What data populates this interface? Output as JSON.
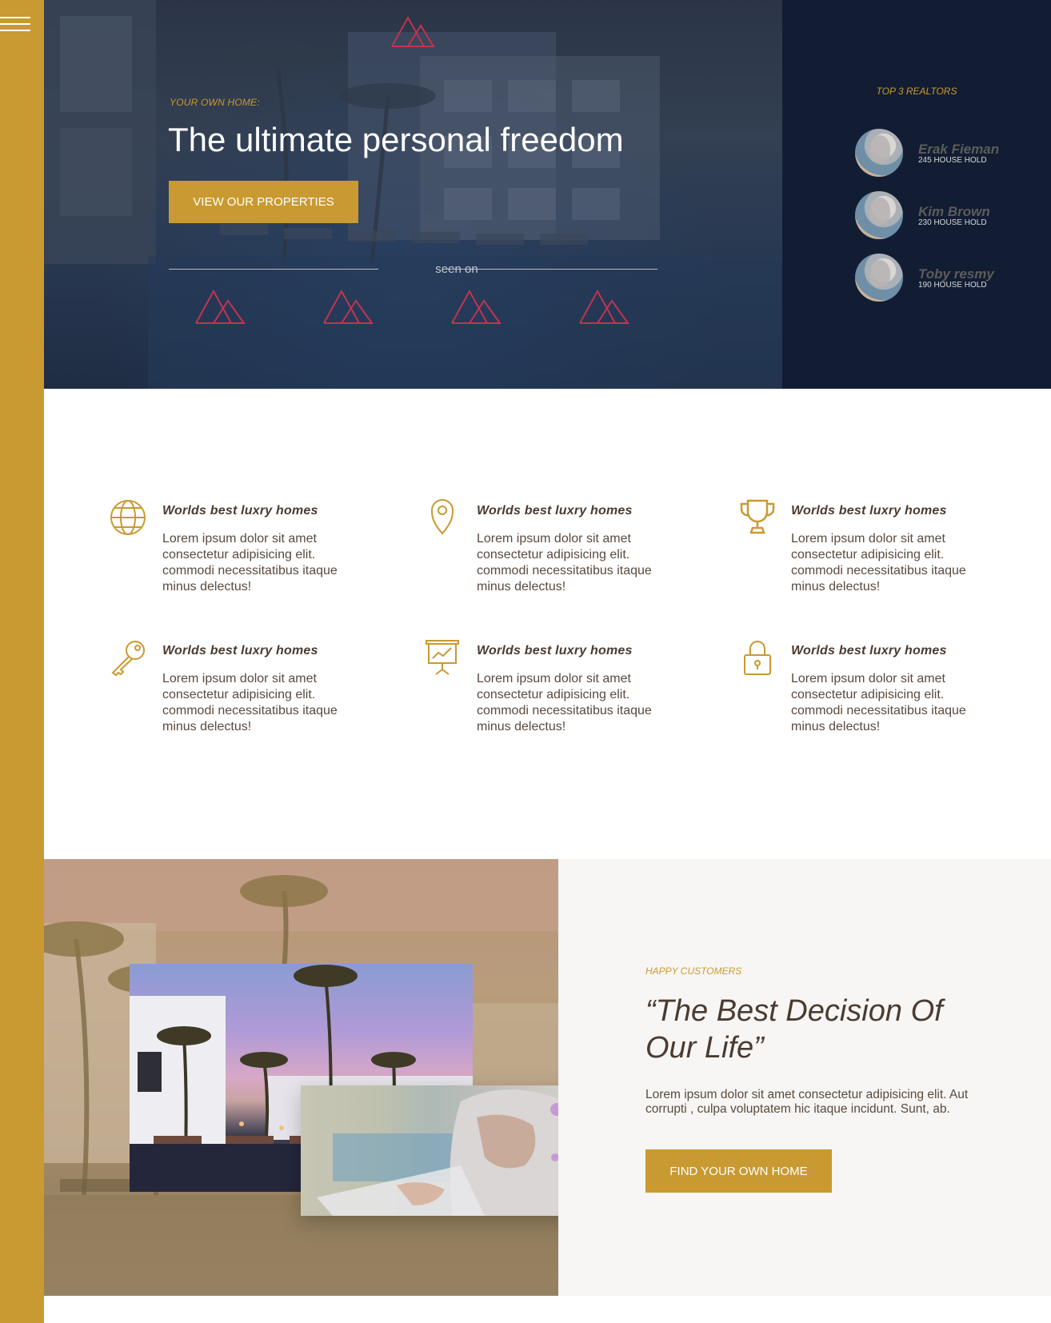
{
  "nav": {
    "menu_icon": "hamburger-icon"
  },
  "hero": {
    "logo_icon": "mountain-logo-icon",
    "eyebrow": "YOUR OWN HOME:",
    "title": "The ultimate personal freedom",
    "cta_label": "VIEW OUR PROPERTIES",
    "seen_on": "seen on",
    "press_logos": [
      "mountain-logo-icon",
      "mountain-logo-icon",
      "mountain-logo-icon",
      "mountain-logo-icon"
    ]
  },
  "realtors": {
    "title": "TOP 3 REALTORS",
    "items": [
      {
        "name": "Erak Fieman",
        "households": "245 HOUSE HOLD"
      },
      {
        "name": "Kim Brown",
        "households": "230 HOUSE HOLD"
      },
      {
        "name": "Toby resmy",
        "households": "190 HOUSE HOLD"
      }
    ]
  },
  "features": [
    {
      "icon": "globe-icon",
      "title": "Worlds best luxry homes",
      "text": "Lorem ipsum dolor sit amet consectetur adipisicing elit. commodi necessitatibus itaque minus delectus!"
    },
    {
      "icon": "map-pin-icon",
      "title": "Worlds best luxry homes",
      "text": "Lorem ipsum dolor sit amet consectetur adipisicing elit. commodi necessitatibus itaque minus delectus!"
    },
    {
      "icon": "trophy-icon",
      "title": "Worlds best luxry homes",
      "text": "Lorem ipsum dolor sit amet consectetur adipisicing elit. commodi necessitatibus itaque minus delectus!"
    },
    {
      "icon": "key-icon",
      "title": "Worlds best luxry homes",
      "text": "Lorem ipsum dolor sit amet consectetur adipisicing elit. commodi necessitatibus itaque minus delectus!"
    },
    {
      "icon": "presentation-chart-icon",
      "title": "Worlds best luxry homes",
      "text": "Lorem ipsum dolor sit amet consectetur adipisicing elit. commodi necessitatibus itaque minus delectus!"
    },
    {
      "icon": "padlock-icon",
      "title": "Worlds best luxry homes",
      "text": "Lorem ipsum dolor sit amet consectetur adipisicing elit. commodi necessitatibus itaque minus delectus!"
    }
  ],
  "testimonial": {
    "eyebrow": "HAPPY CUSTOMERS",
    "quote": "“The Best Decision Of Our Life”",
    "text": "Lorem ipsum dolor sit amet consectetur adipisicing elit. Aut corrupti , culpa voluptatem hic itaque incidunt. Sunt, ab.",
    "cta_label": "FIND YOUR OWN HOME"
  },
  "colors": {
    "accent": "#c99a31",
    "navy": "#121d33",
    "logo_red": "#c2334f",
    "text_brown": "#4a3b31",
    "panel_bg": "#f7f6f4"
  }
}
